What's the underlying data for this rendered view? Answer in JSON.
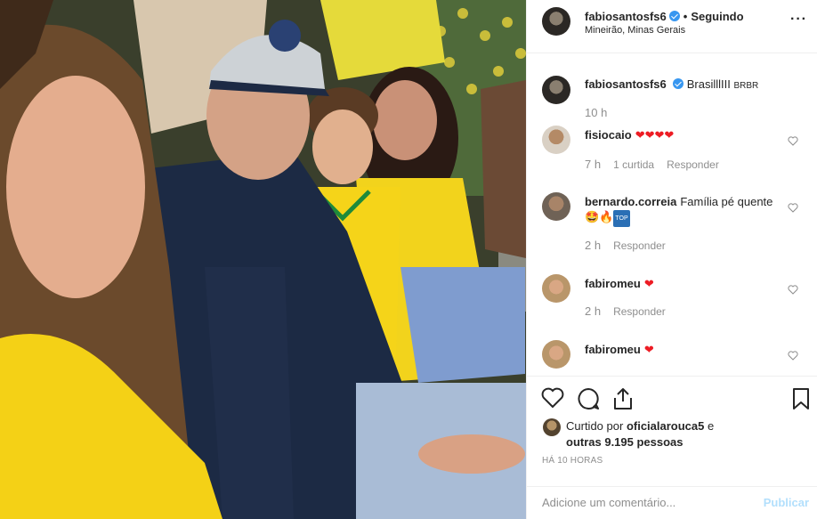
{
  "post": {
    "author": "fabiosantosfs6",
    "follow_status": "Seguindo",
    "separator": "•",
    "location": "Mineirão, Minas Gerais",
    "more_icon": "more-options-icon"
  },
  "caption": {
    "author": "fabiosantosfs6",
    "text": "BrasilllIII",
    "flags": "BRBR",
    "time": "10 h"
  },
  "comments": [
    {
      "user": "fisiocaio",
      "text": "",
      "emoji": "❤❤❤❤",
      "time": "7 h",
      "likes": "1 curtida",
      "reply": "Responder"
    },
    {
      "user": "bernardo.correia",
      "text": "Família pé quente",
      "emoji": "🤩🔥",
      "badge": "TOP",
      "time": "2 h",
      "reply": "Responder"
    },
    {
      "user": "fabiromeu",
      "text": "",
      "emoji": "❤",
      "time": "2 h",
      "reply": "Responder"
    },
    {
      "user": "fabiromeu",
      "text": "",
      "emoji": "❤"
    }
  ],
  "actions": {
    "liked_prefix": "Curtido por",
    "liked_user": "oficialarouca5",
    "liked_and": "e",
    "liked_others": "outras 9.195 pessoas",
    "timestamp": "HÁ 10 HORAS"
  },
  "add_comment": {
    "placeholder": "Adicione um comentário...",
    "publish": "Publicar"
  },
  "colors": {
    "verified": "#3897f0",
    "publish_disabled": "#b2dffc",
    "heart": "#ed1c24"
  }
}
